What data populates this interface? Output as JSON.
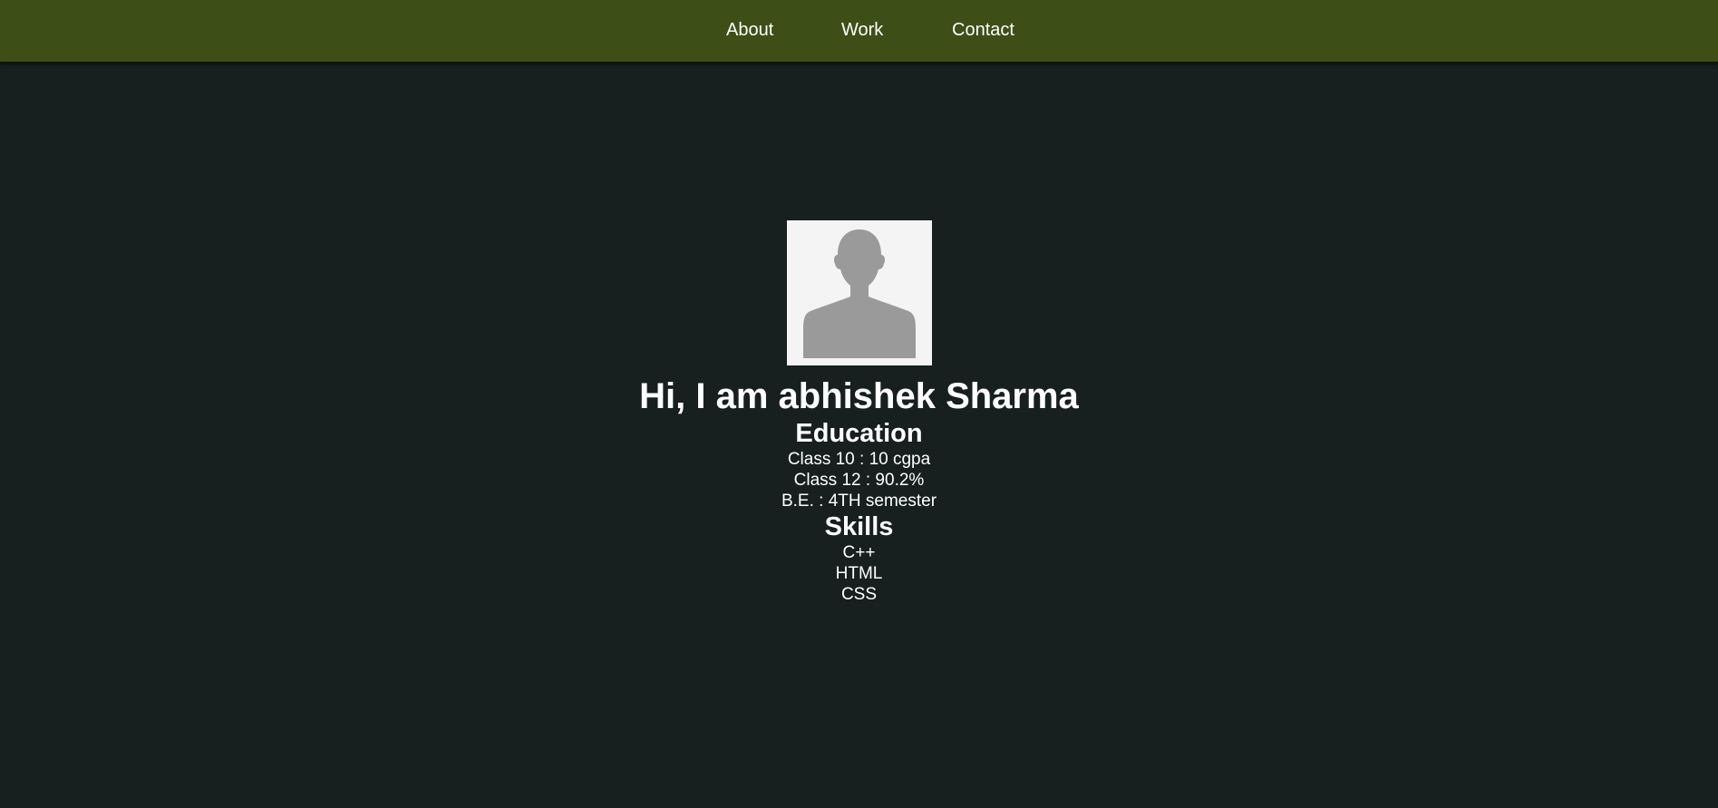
{
  "nav": {
    "items": [
      {
        "label": "About"
      },
      {
        "label": "Work"
      },
      {
        "label": "Contact"
      }
    ]
  },
  "profile": {
    "avatar_icon": "person-silhouette-icon",
    "greeting": "Hi, I am abhishek Sharma"
  },
  "education": {
    "heading": "Education",
    "items": [
      "Class 10 : 10 cgpa",
      "Class 12 : 90.2%",
      "B.E. : 4TH semester"
    ]
  },
  "skills": {
    "heading": "Skills",
    "items": [
      "C++",
      "HTML",
      "CSS"
    ]
  },
  "colors": {
    "navbar": "#3d4f17",
    "background": "#171f1f",
    "text": "#ffffff",
    "avatar_bg": "#f4f4f4",
    "avatar_figure": "#9a9a9a"
  }
}
